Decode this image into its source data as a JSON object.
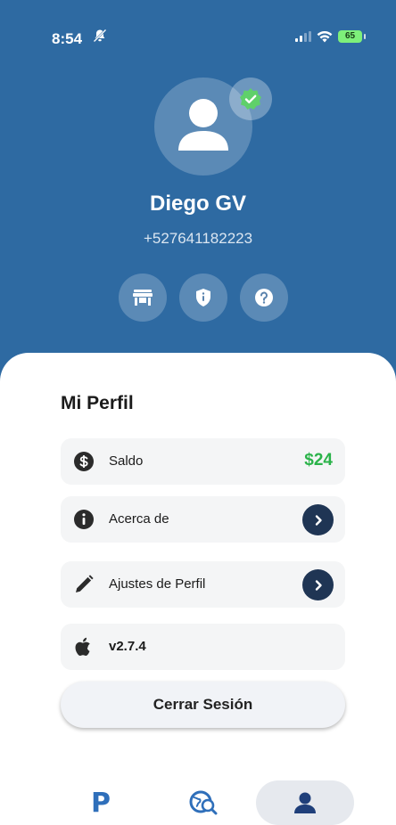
{
  "status_bar": {
    "time": "8:54",
    "battery": "65"
  },
  "profile": {
    "name": "Diego GV",
    "phone": "+527641182223",
    "quick_actions": [
      "store-icon",
      "shield-icon",
      "help-icon"
    ]
  },
  "section": {
    "title": "Mi Perfil",
    "rows": [
      {
        "icon": "dollar-circle-icon",
        "label": "Saldo",
        "value": "$24"
      },
      {
        "icon": "info-icon",
        "label": "Acerca de"
      },
      {
        "icon": "pencil-icon",
        "label": "Ajustes de Perfil"
      },
      {
        "icon": "apple-icon",
        "label": "v2.7.4"
      }
    ],
    "logout_label": "Cerrar Sesión"
  },
  "bottom_nav": {
    "items": [
      {
        "icon": "parking-icon",
        "label": "P",
        "active": false
      },
      {
        "icon": "search-location-icon",
        "active": false
      },
      {
        "icon": "user-icon",
        "active": true
      }
    ]
  },
  "colors": {
    "header": "#2e6aa2",
    "accent_green": "#2bb34a",
    "chevron_bg": "#1f3554",
    "nav_blue": "#2f6fba"
  }
}
